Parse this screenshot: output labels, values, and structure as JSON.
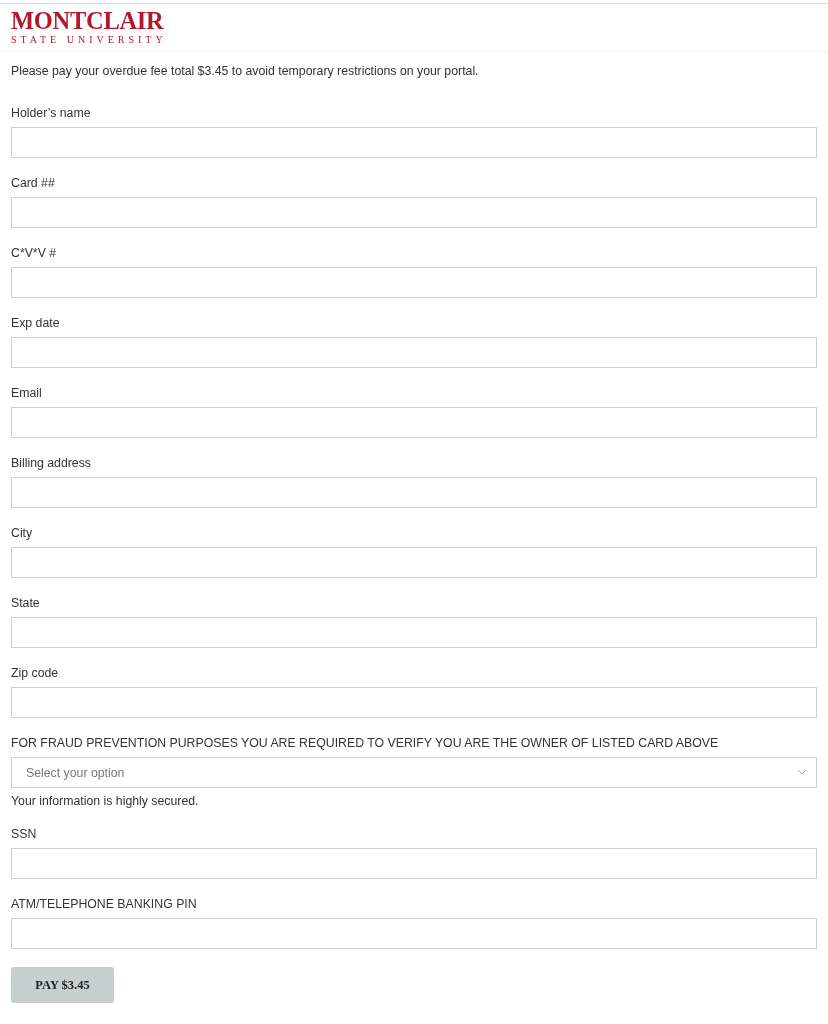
{
  "header": {
    "logo": {
      "title": "MONTCLAIR",
      "subtitle": "STATE UNIVERSITY"
    }
  },
  "notice": "Please pay your overdue fee total $3.45 to avoid temporary restrictions on your portal.",
  "form": {
    "fields": [
      {
        "kind": "text",
        "label": "Holder’s name"
      },
      {
        "kind": "text",
        "label": "Card ##"
      },
      {
        "kind": "text",
        "label": "C*V*V #"
      },
      {
        "kind": "text",
        "label": "Exp date"
      },
      {
        "kind": "text",
        "label": "Email"
      },
      {
        "kind": "text",
        "label": "Billing address"
      },
      {
        "kind": "text",
        "label": "City"
      },
      {
        "kind": "text",
        "label": "State"
      },
      {
        "kind": "text",
        "label": "Zip code"
      },
      {
        "kind": "select",
        "label": "FOR FRAUD PREVENTION PURPOSES YOU ARE REQUIRED TO VERIFY YOU ARE THE OWNER OF LISTED CARD ABOVE",
        "placeholder": "Select your option",
        "note": "Your information is highly secured."
      },
      {
        "kind": "text",
        "label": "SSN"
      },
      {
        "kind": "text",
        "label": "ATM/TELEPHONE BANKING PIN"
      }
    ],
    "submit": "PAY $3.45"
  }
}
